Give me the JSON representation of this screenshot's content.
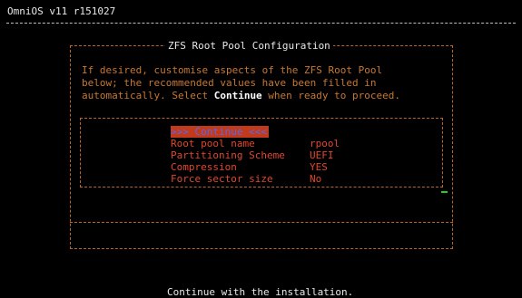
{
  "header": {
    "title": "OmniOS v11 r151027"
  },
  "dialog": {
    "title": "ZFS Root Pool Configuration",
    "lines": [
      "If desired, customise aspects of the ZFS Root Pool",
      "below; the recommended values have been filled in"
    ],
    "line3_before": "automatically. Select ",
    "line3_keyword": "Continue",
    "line3_after": " when ready to proceed."
  },
  "menu": {
    "continue_label": ">>> Continue <<<",
    "items": [
      {
        "label": "Root pool name",
        "value": "rpool"
      },
      {
        "label": "Partitioning Scheme",
        "value": "UEFI"
      },
      {
        "label": "Compression",
        "value": "YES"
      },
      {
        "label": "Force sector size",
        "value": "No"
      }
    ]
  },
  "footer": {
    "help_text": "Continue with the installation."
  }
}
